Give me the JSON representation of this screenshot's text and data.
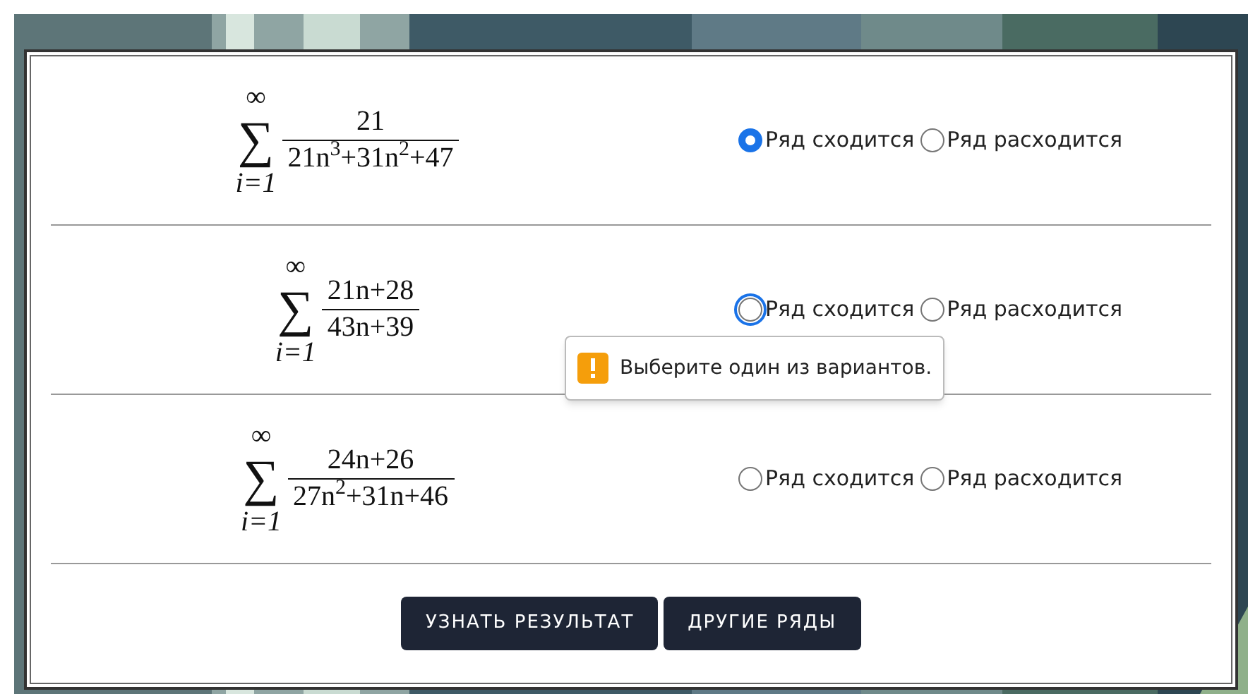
{
  "series": [
    {
      "upper": "∞",
      "symbol": "∑",
      "lower": "i=1",
      "numerator": "21",
      "denominator": "21n$^{3}$+31n$^{2}$+47",
      "options": [
        {
          "label": "Ряд сходится",
          "selected": true,
          "focused": false
        },
        {
          "label": "Ряд расходится",
          "selected": false,
          "focused": false
        }
      ]
    },
    {
      "upper": "∞",
      "symbol": "∑",
      "lower": "i=1",
      "numerator": "21n+28",
      "denominator": "43n+39",
      "options": [
        {
          "label": "Ряд сходится",
          "selected": false,
          "focused": true
        },
        {
          "label": "Ряд расходится",
          "selected": false,
          "focused": false
        }
      ],
      "tooltip": "Выберите один из вариантов."
    },
    {
      "upper": "∞",
      "symbol": "∑",
      "lower": "i=1",
      "numerator": "24n+26",
      "denominator": "27n$^{2}$+31n+46",
      "options": [
        {
          "label": "Ряд сходится",
          "selected": false,
          "focused": false
        },
        {
          "label": "Ряд расходится",
          "selected": false,
          "focused": false
        }
      ]
    }
  ],
  "buttons": [
    "УЗНАТЬ РЕЗУЛЬТАТ",
    "ДРУГИЕ РЯДЫ"
  ]
}
